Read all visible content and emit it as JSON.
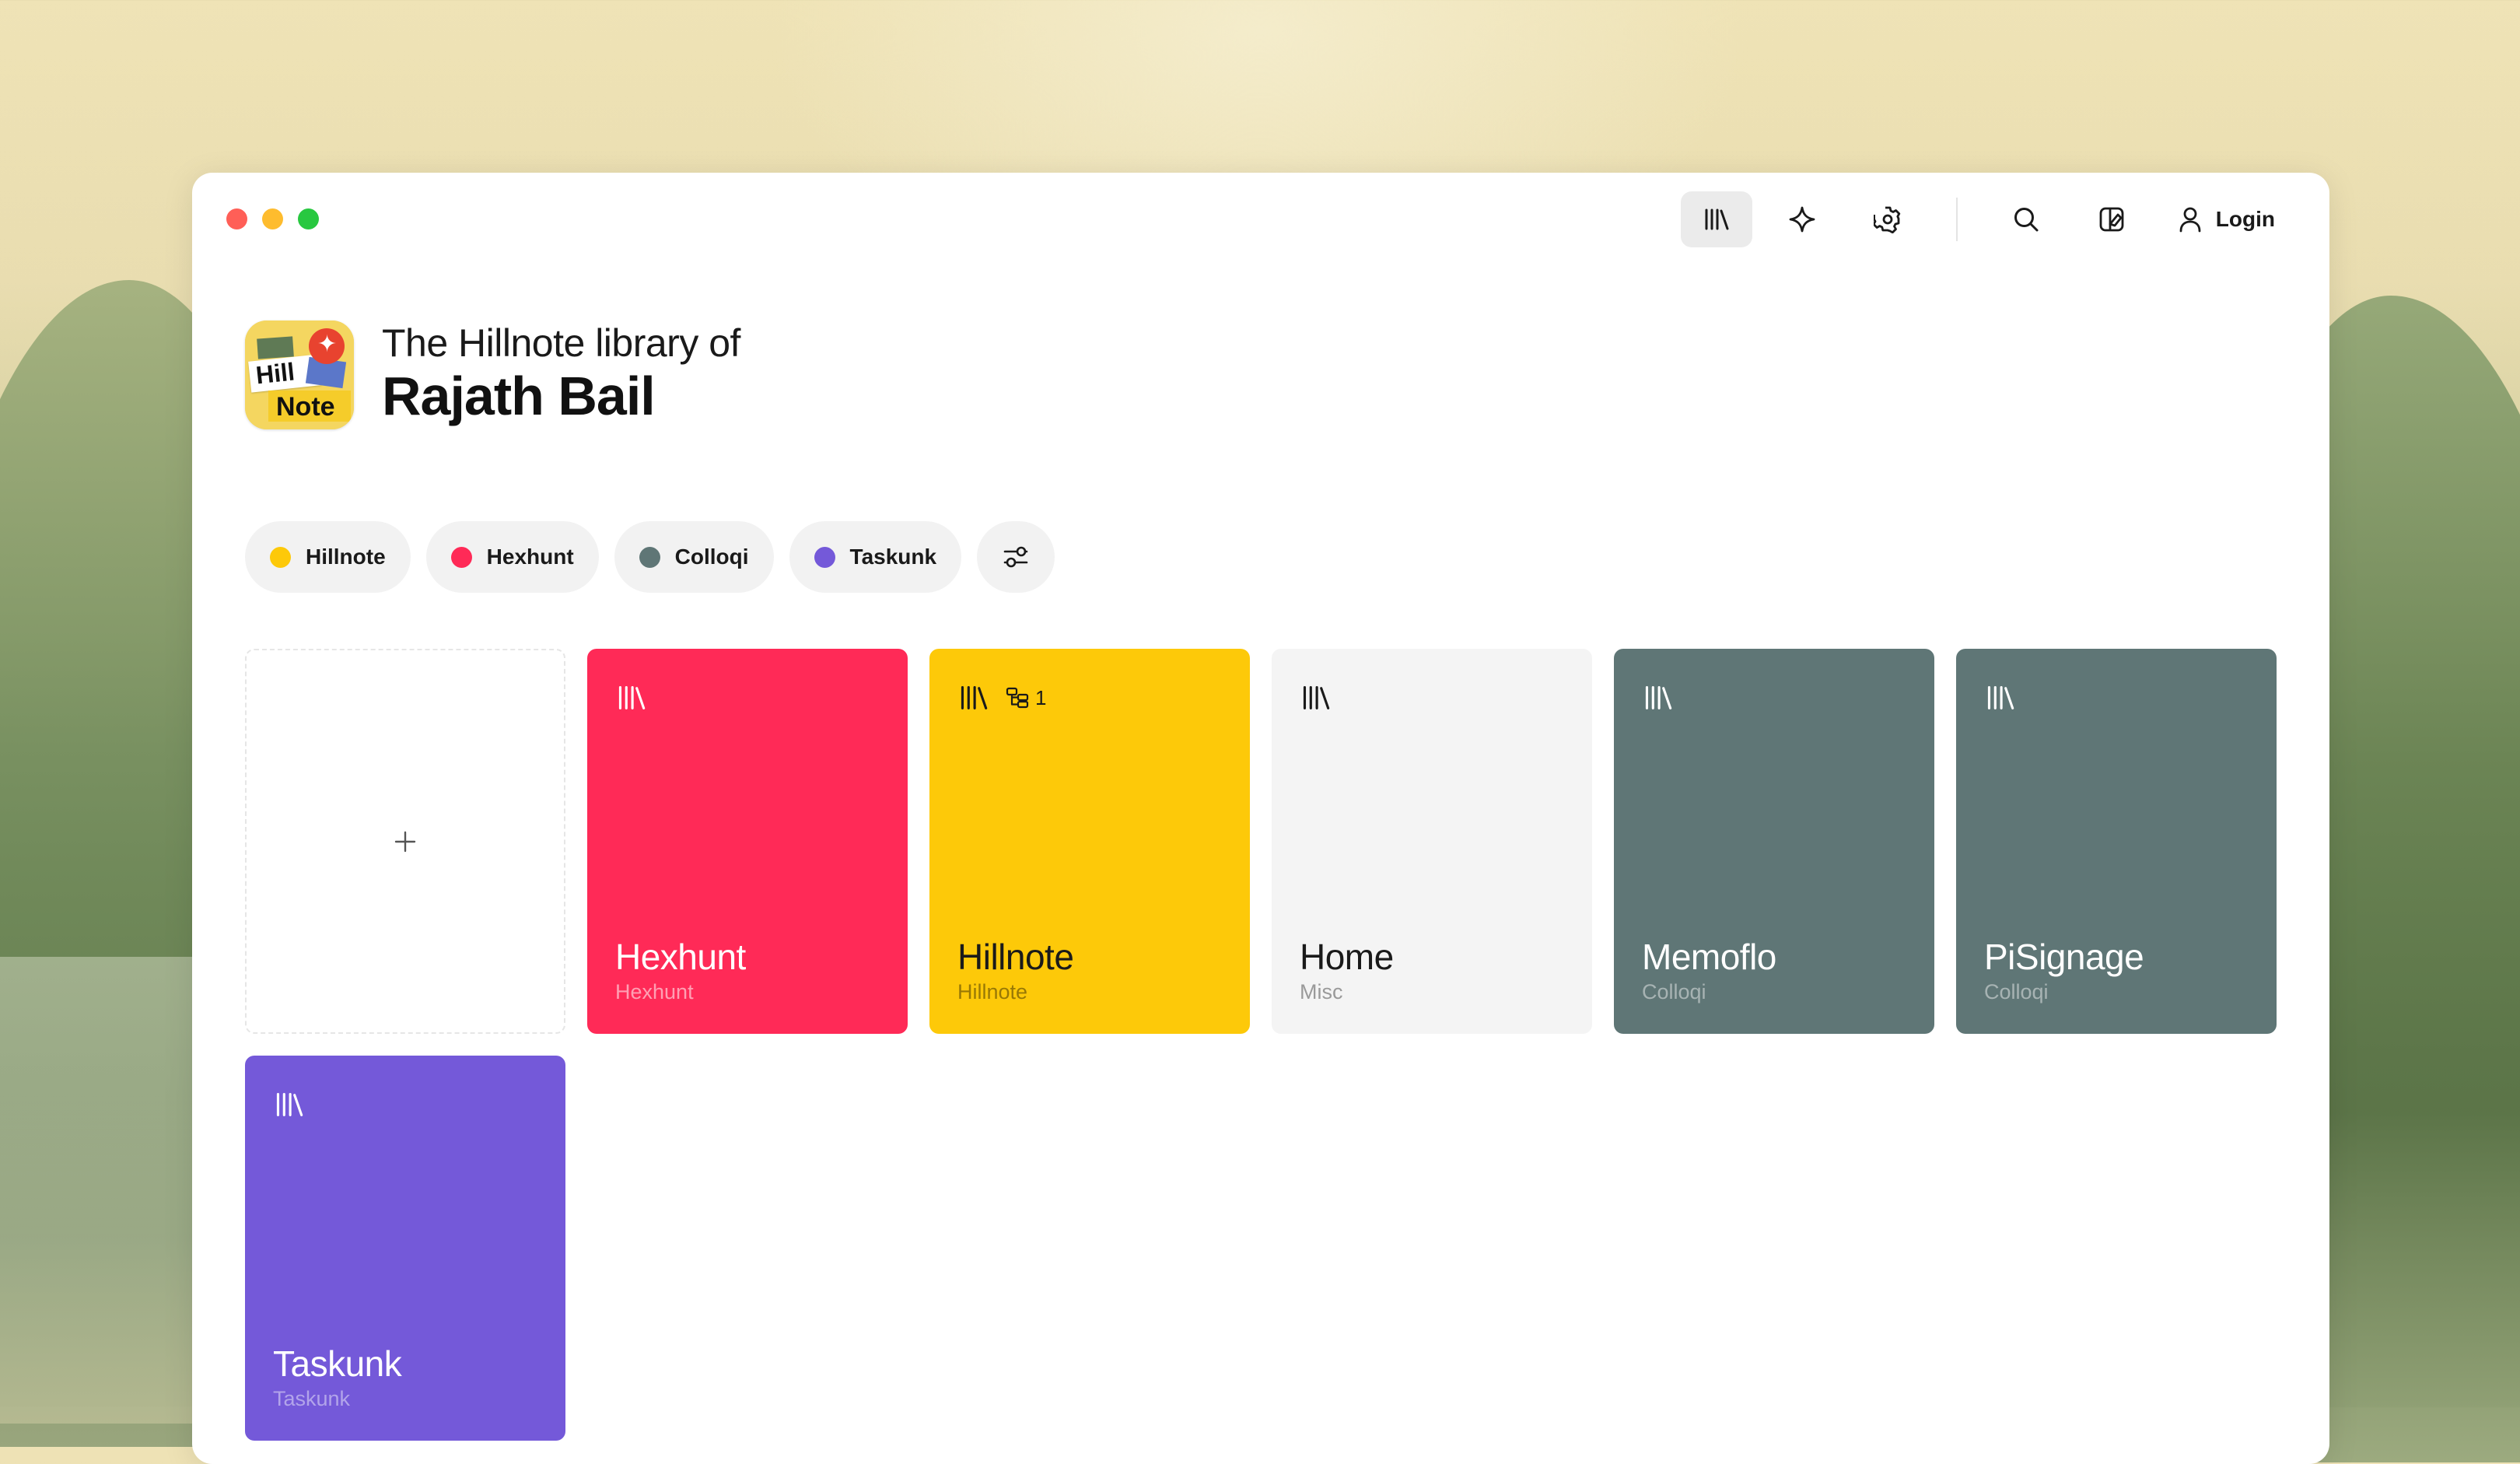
{
  "colors": {
    "window_bg": "#ffffff",
    "hillnote": "#fdc909",
    "hexhunt": "#ff2a57",
    "colloqi": "#5f7676",
    "taskunk": "#7459d9",
    "misc": "#f4f4f4"
  },
  "toolbar": {
    "items": [
      {
        "name": "library-icon",
        "active": true
      },
      {
        "name": "sparkle-icon"
      },
      {
        "name": "gear-icon"
      },
      {
        "name": "search-icon"
      },
      {
        "name": "layout-icon"
      }
    ],
    "login_label": "Login"
  },
  "header": {
    "subtitle": "The Hillnote library of",
    "name": "Rajath Bail"
  },
  "filters": [
    {
      "label": "Hillnote",
      "color": "#fdc909"
    },
    {
      "label": "Hexhunt",
      "color": "#ff2a57"
    },
    {
      "label": "Colloqi",
      "color": "#5f7676"
    },
    {
      "label": "Taskunk",
      "color": "#7459d9"
    }
  ],
  "add_card": {
    "icon": "plus-icon"
  },
  "cards": [
    {
      "title": "Hexhunt",
      "tag": "Hexhunt",
      "bg": "#ff2a57",
      "fg": "#ffffff",
      "tag_fg": "rgba(255,255,255,0.55)",
      "icon": "library-icon"
    },
    {
      "title": "Hillnote",
      "tag": "Hillnote",
      "bg": "#fdc909",
      "fg": "#1a1a1a",
      "tag_fg": "rgba(0,0,0,0.40)",
      "icon": "library-icon",
      "sub_count": "1",
      "sub_icon": "hierarchy-icon"
    },
    {
      "title": "Home",
      "tag": "Misc",
      "bg": "#f4f4f4",
      "fg": "#1a1a1a",
      "tag_fg": "#9a9a9a",
      "icon": "library-icon"
    },
    {
      "title": "Memoflo",
      "tag": "Colloqi",
      "bg": "#5f7676",
      "fg": "#ffffff",
      "tag_fg": "rgba(255,255,255,0.45)",
      "icon": "library-icon"
    },
    {
      "title": "PiSignage",
      "tag": "Colloqi",
      "bg": "#5f7676",
      "fg": "#ffffff",
      "tag_fg": "rgba(255,255,255,0.45)",
      "icon": "library-icon"
    },
    {
      "title": "Taskunk",
      "tag": "Taskunk",
      "bg": "#7459d9",
      "fg": "#ffffff",
      "tag_fg": "rgba(255,255,255,0.45)",
      "icon": "library-icon"
    }
  ]
}
